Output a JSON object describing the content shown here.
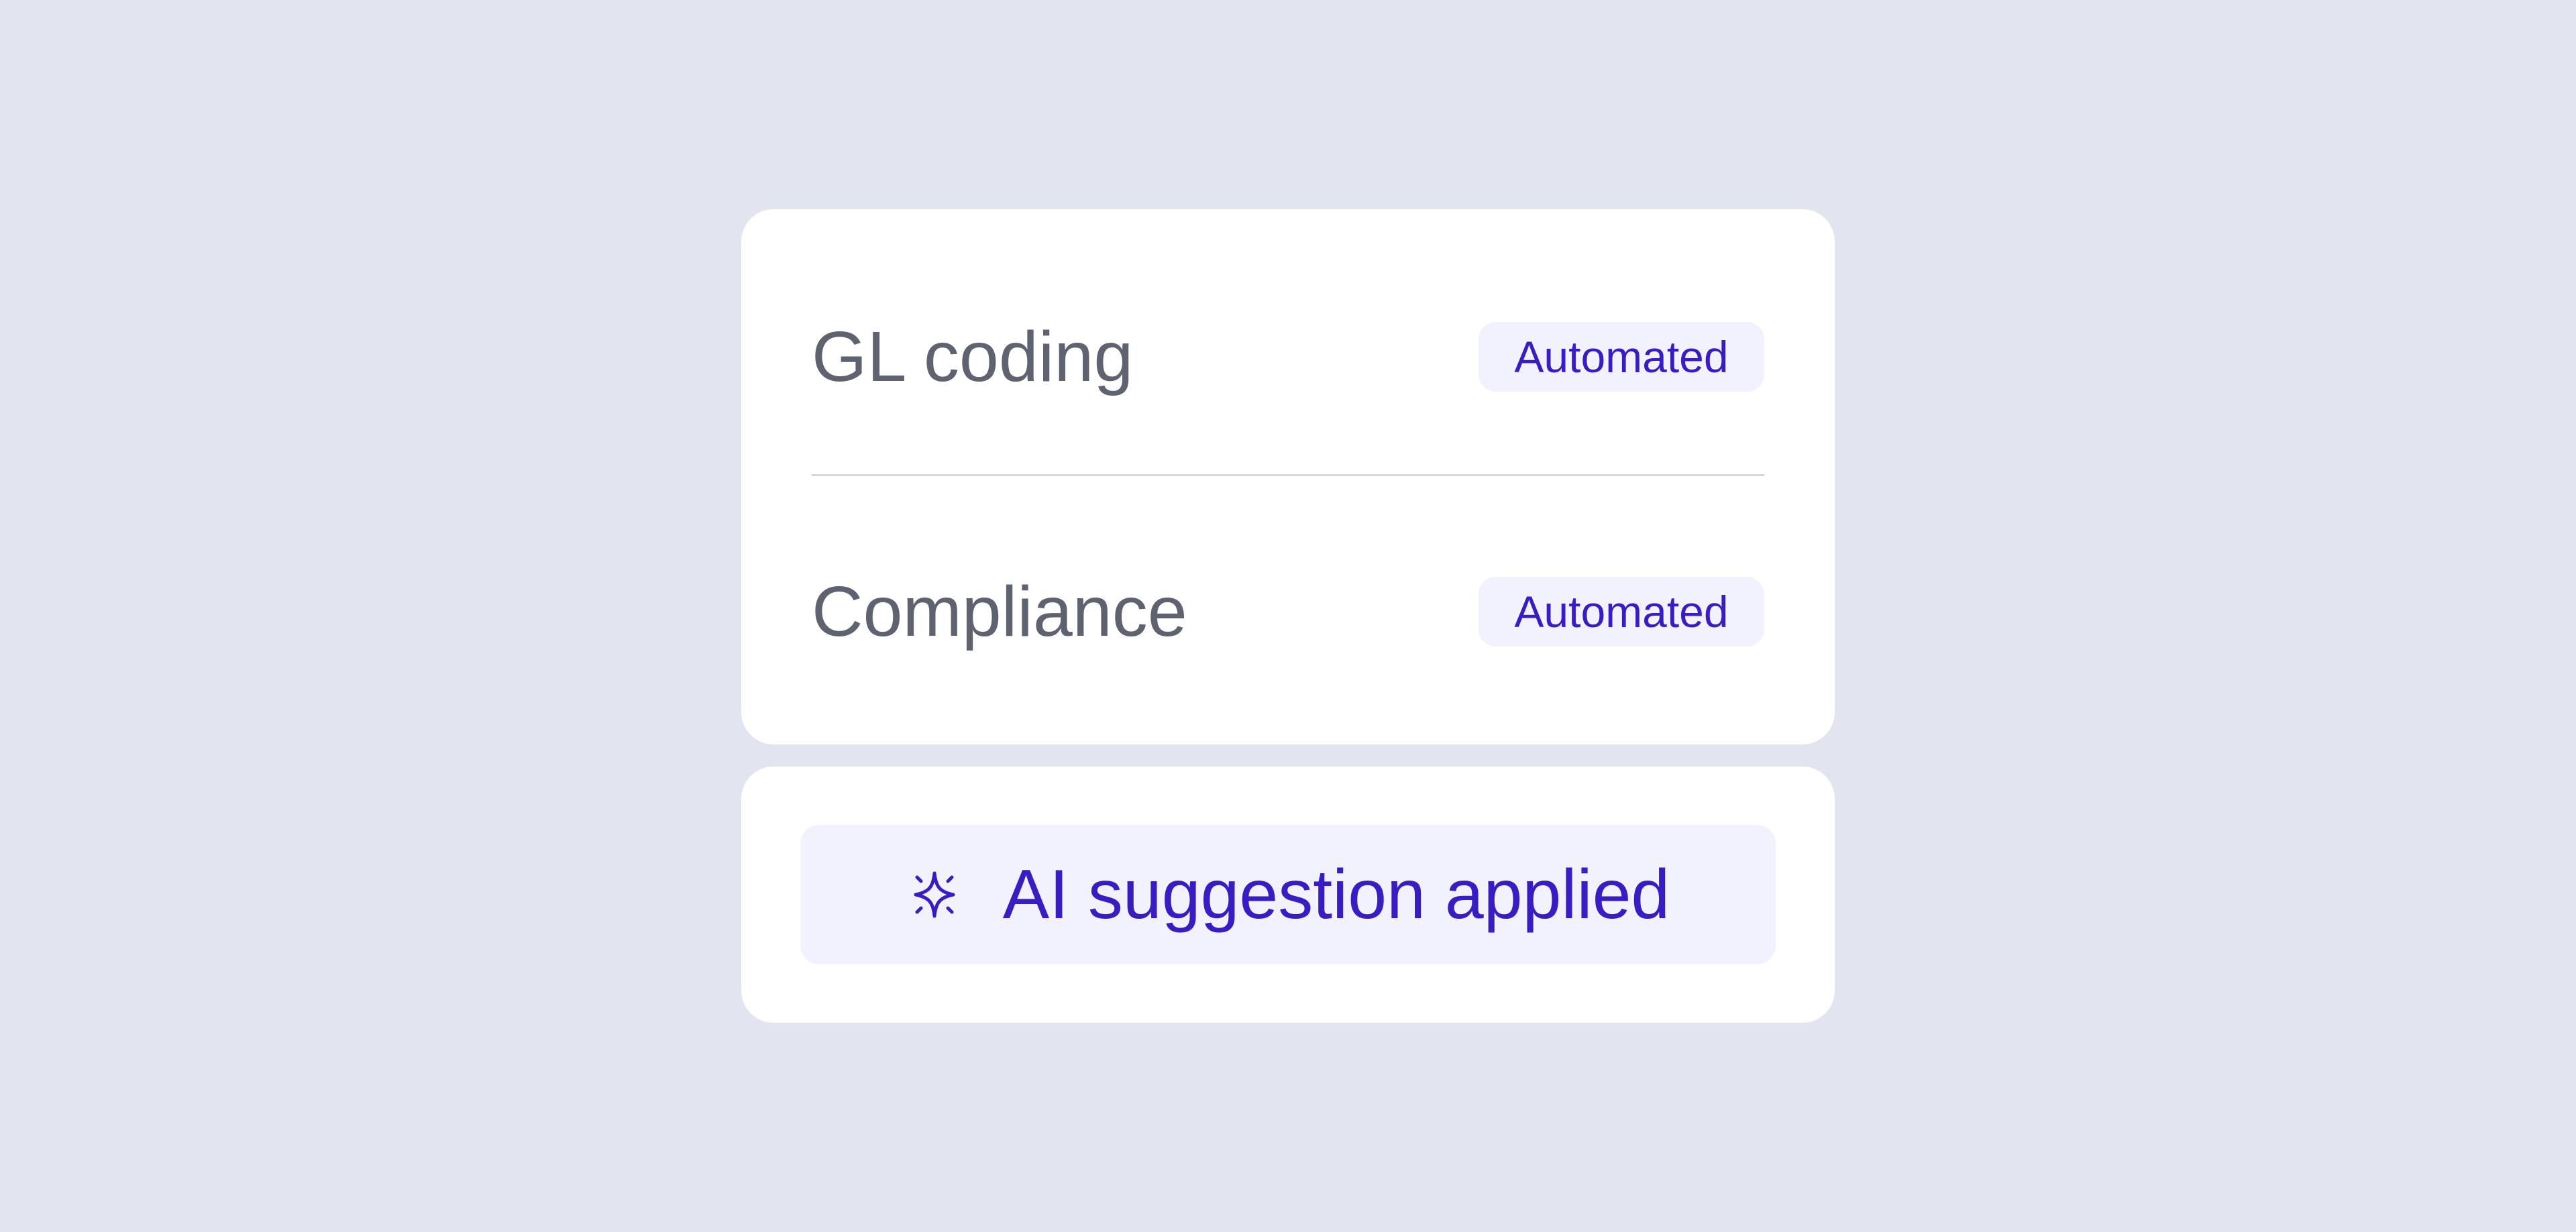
{
  "rows": [
    {
      "label": "GL coding",
      "badge": "Automated"
    },
    {
      "label": "Compliance",
      "badge": "Automated"
    }
  ],
  "suggestion": {
    "icon": "sparkle-icon",
    "text": "AI suggestion applied"
  },
  "colors": {
    "background": "#e2e5ef",
    "card": "#ffffff",
    "accent": "#3a1dc2",
    "badge_bg": "#f2f1fe",
    "label_text": "#5f6370"
  }
}
